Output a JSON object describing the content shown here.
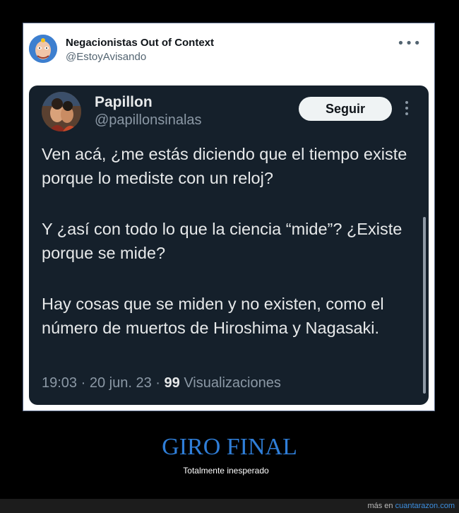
{
  "outer_tweet": {
    "author_name": "Negacionistas Out of Context",
    "author_handle": "@EstoyAvisando",
    "more_icon": "more-horizontal-icon"
  },
  "inner_tweet": {
    "author_name": "Papillon",
    "author_handle": "@papillonsinalas",
    "follow_label": "Seguir",
    "more_icon": "more-vertical-icon",
    "paragraphs": [
      "Ven acá, ¿me estás diciendo que el tiempo existe porque lo mediste con un reloj?",
      "Y ¿así con todo lo que la ciencia “mide”? ¿Existe porque se mide?",
      "Hay cosas que se miden y no existen, como el número de muertos de Hiroshima y Nagasaki."
    ],
    "time": "19:03",
    "separator": "·",
    "date": "20 jun. 23",
    "views_count": "99",
    "views_label": "Visualizaciones"
  },
  "caption": {
    "title": "GIRO FINAL",
    "subtitle": "Totalmente inesperado"
  },
  "footer": {
    "prefix": "más en",
    "site": "cuantarazon.com"
  },
  "colors": {
    "inner_bg": "#15202b",
    "caption_title": "#2f7ed8",
    "follow_bg": "#eff3f4",
    "outer_avatar_bg": "#3d7fcf"
  }
}
